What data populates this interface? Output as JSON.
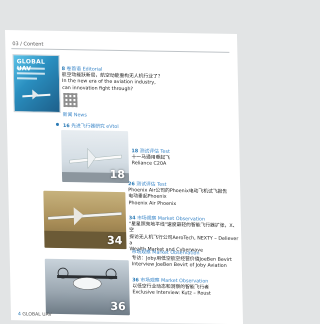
{
  "running_head": "03 / Content",
  "cover": {
    "title": "GLOBAL UAV"
  },
  "entries": [
    {
      "num": "8",
      "tag": "卷首语 Editorial",
      "lines": [
        "航空动能跃新局，航空动能重构无人机行业了？",
        "In the new era of the aviation industry,",
        "can innovation fight through?"
      ]
    },
    {
      "num": "",
      "tag": "新闻 News",
      "lines": []
    },
    {
      "num": "16",
      "tag": "先进飞行器研究 eVtol",
      "lines": []
    },
    {
      "num": "18",
      "tag": "测试评估 Test",
      "lines": [
        "十一马通用垂起飞",
        "Reliance C20A"
      ]
    },
    {
      "num": "26",
      "tag": "测试评估 Test",
      "lines": [
        "Phoenix Air公司的Phoenix电动飞机试飞报告",
        "电动垂起Phoenix",
        "Phoenix Air Phoenix"
      ]
    },
    {
      "num": "34",
      "tag": "市场观察 Market Observation",
      "lines": [
        "\"星星照亮地平线\"速度最轻的智能飞行器扩张，X、空",
        "探访无人机飞行公司AeroTech, NEXTY – Deliever a",
        "Wealth Market and Cyberwave"
      ]
    },
    {
      "num": "",
      "tag": "市场观察 Market Observation",
      "lines": [
        "专访：Joby用低空航空经营价值JoeBen Bevirt",
        "Interview JoeBen Bevirt of Joby Aviation"
      ]
    },
    {
      "num": "36",
      "tag": "市场观察 Market Observation",
      "lines": [
        "以低空行业动态和洞察的智能飞行者",
        "Exclusive Interview: Kutz – Roust"
      ]
    }
  ],
  "photos": [
    {
      "num": "18"
    },
    {
      "num": "34"
    },
    {
      "num": "36"
    }
  ],
  "footer": {
    "page": "4",
    "label": "GLOBAL UAV"
  }
}
